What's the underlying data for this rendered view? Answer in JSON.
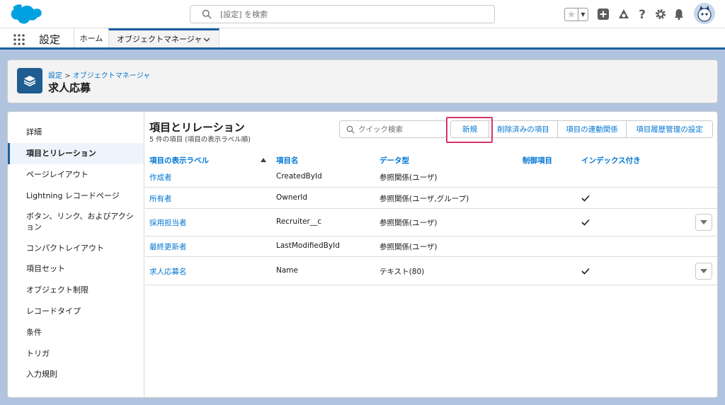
{
  "header": {
    "search_placeholder": "[設定] を検索"
  },
  "context": {
    "app_name": "設定",
    "tabs": [
      {
        "label": "ホーム"
      },
      {
        "label": "オブジェクトマネージャ"
      }
    ]
  },
  "page": {
    "breadcrumb_root": "設定",
    "breadcrumb_sep": ">",
    "breadcrumb_current": "オブジェクトマネージャ",
    "title": "求人応募"
  },
  "sidebar": {
    "items": [
      {
        "label": "詳細"
      },
      {
        "label": "項目とリレーション"
      },
      {
        "label": "ページレイアウト"
      },
      {
        "label": "Lightning レコードページ"
      },
      {
        "label": "ボタン、リンク、およびアクション"
      },
      {
        "label": "コンパクトレイアウト"
      },
      {
        "label": "項目セット"
      },
      {
        "label": "オブジェクト制限"
      },
      {
        "label": "レコードタイプ"
      },
      {
        "label": "条件"
      },
      {
        "label": "トリガ"
      },
      {
        "label": "入力規則"
      }
    ]
  },
  "section": {
    "title": "項目とリレーション",
    "subtitle": "5 件の項目 (項目の表示ラベル順)",
    "quick_search_placeholder": "クイック検索",
    "buttons": {
      "new": "新規",
      "deleted": "削除済みの項目",
      "dependencies": "項目の連動関係",
      "history": "項目履歴管理の設定"
    }
  },
  "table": {
    "columns": [
      "項目の表示ラベル",
      "項目名",
      "データ型",
      "制御項目",
      "インデックス付き"
    ],
    "rows": [
      {
        "label": "作成者",
        "api": "CreatedById",
        "type": "参照関係(ユーザ)",
        "control": "",
        "indexed": false,
        "menu": false
      },
      {
        "label": "所有者",
        "api": "OwnerId",
        "type": "参照関係(ユーザ,グループ)",
        "control": "",
        "indexed": true,
        "menu": false
      },
      {
        "label": "採用担当者",
        "api": "Recruiter__c",
        "type": "参照関係(ユーザ)",
        "control": "",
        "indexed": true,
        "menu": true
      },
      {
        "label": "最終更新者",
        "api": "LastModifiedById",
        "type": "参照関係(ユーザ)",
        "control": "",
        "indexed": false,
        "menu": false
      },
      {
        "label": "求人応募名",
        "api": "Name",
        "type": "テキスト(80)",
        "control": "",
        "indexed": true,
        "menu": true
      }
    ]
  },
  "colors": {
    "accent": "#0176d3",
    "brand": "#00a1e0",
    "highlight": "#d6336c"
  }
}
